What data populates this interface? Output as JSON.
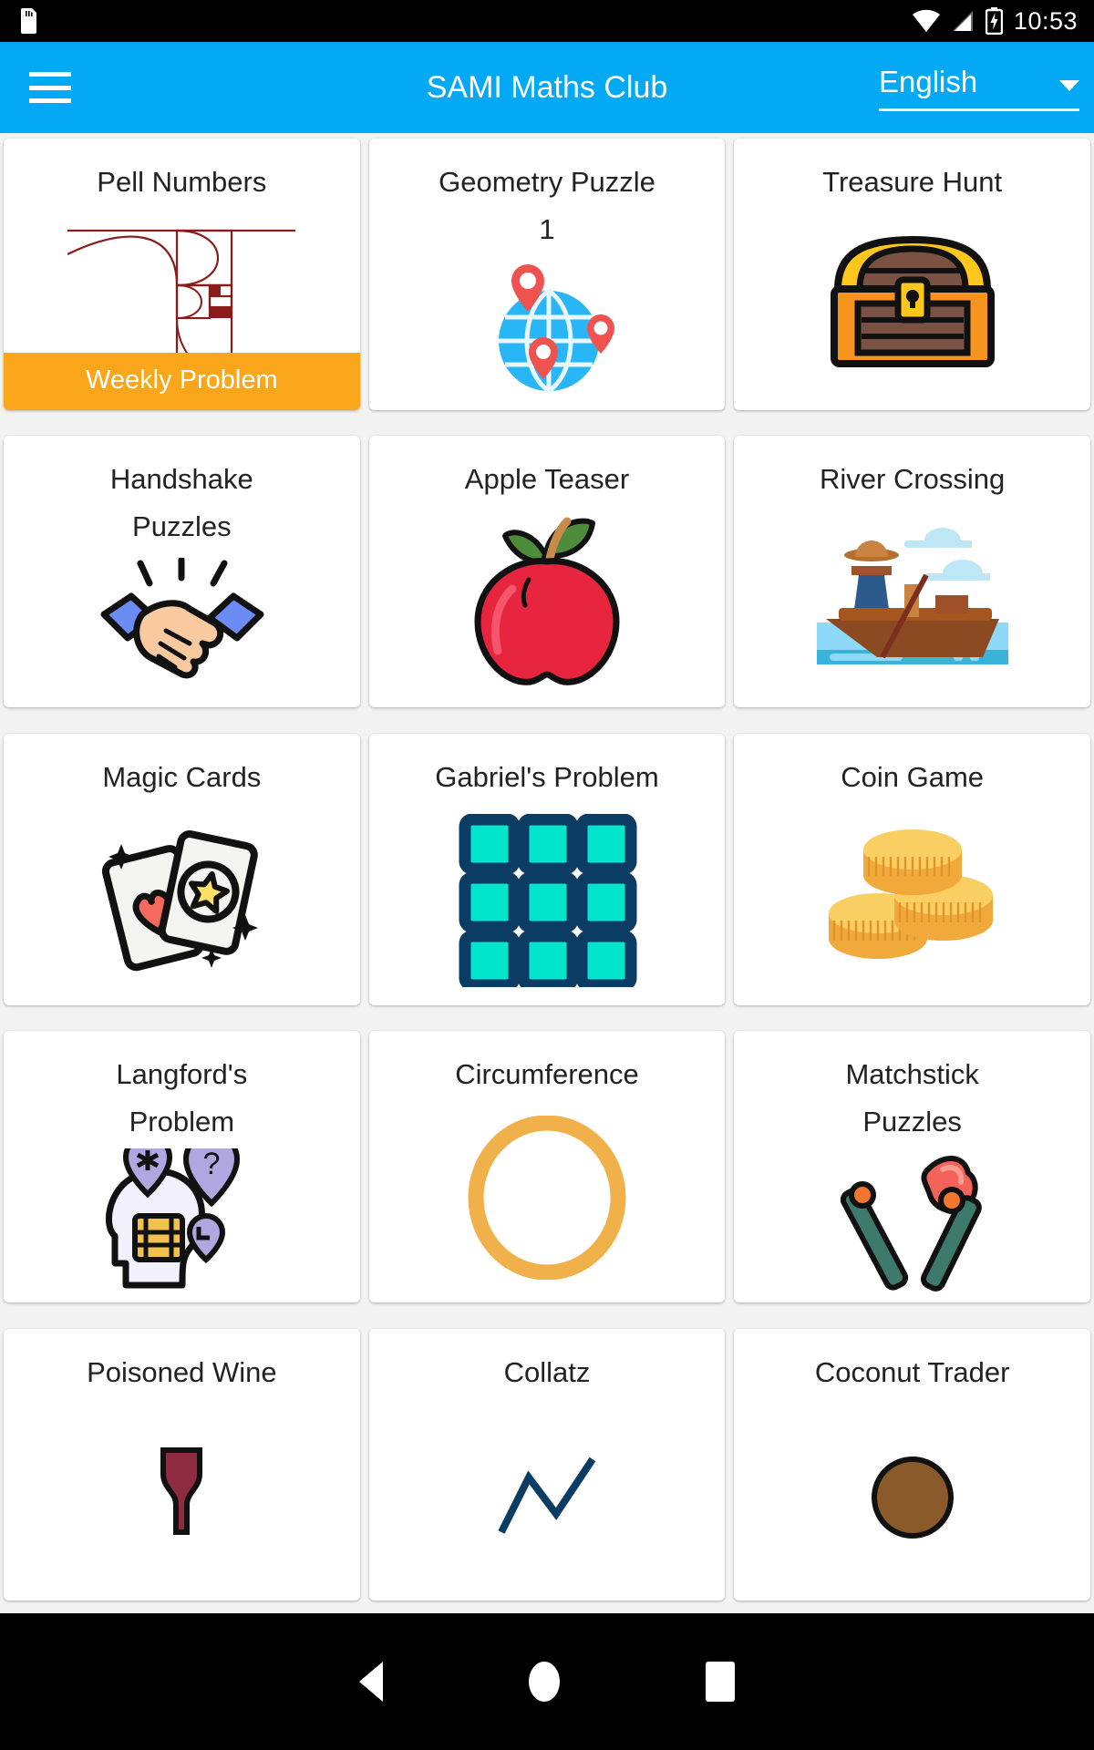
{
  "status_bar": {
    "time": "10:53",
    "icons": [
      "sd-card-icon",
      "wifi-icon",
      "signal-icon",
      "battery-charging-icon"
    ]
  },
  "app_bar": {
    "menu_icon": "hamburger-menu-icon",
    "title": "SAMI Maths Club",
    "language": {
      "selected": "English",
      "caret_icon": "chevron-down-icon"
    },
    "background_color": "#03A9F4"
  },
  "theme": {
    "accent": "#03A9F4",
    "badge": "#FAA61A",
    "page_background": "#f2f2f2",
    "card_background": "#ffffff"
  },
  "grid": {
    "columns": 3,
    "cards": [
      {
        "title": "Pell Numbers",
        "icon": "golden-spiral-icon",
        "badge": "Weekly Problem"
      },
      {
        "title": "Geometry Puzzle\n1",
        "icon": "globe-pins-icon",
        "badge": null
      },
      {
        "title": "Treasure Hunt",
        "icon": "treasure-chest-icon",
        "badge": null
      },
      {
        "title": "Handshake\nPuzzles",
        "icon": "handshake-icon",
        "badge": null
      },
      {
        "title": "Apple Teaser",
        "icon": "apple-icon",
        "badge": null
      },
      {
        "title": "River Crossing",
        "icon": "boat-river-icon",
        "badge": null
      },
      {
        "title": "Magic Cards",
        "icon": "playing-cards-icon",
        "badge": null
      },
      {
        "title": "Gabriel's Problem",
        "icon": "grid-squares-icon",
        "badge": null
      },
      {
        "title": "Coin Game",
        "icon": "coin-stack-icon",
        "badge": null
      },
      {
        "title": "Langford's\nProblem",
        "icon": "brain-head-icon",
        "badge": null
      },
      {
        "title": "Circumference",
        "icon": "ring-circle-icon",
        "badge": null
      },
      {
        "title": "Matchstick\nPuzzles",
        "icon": "matchsticks-icon",
        "badge": null
      },
      {
        "title": "Poisoned Wine",
        "icon": "wine-icon",
        "badge": null
      },
      {
        "title": "Collatz",
        "icon": "collatz-icon",
        "badge": null
      },
      {
        "title": "Coconut Trader",
        "icon": "coconut-icon",
        "badge": null
      }
    ]
  },
  "nav_bar": {
    "back_label": "back-button",
    "home_label": "home-button",
    "recents_label": "recents-button"
  }
}
